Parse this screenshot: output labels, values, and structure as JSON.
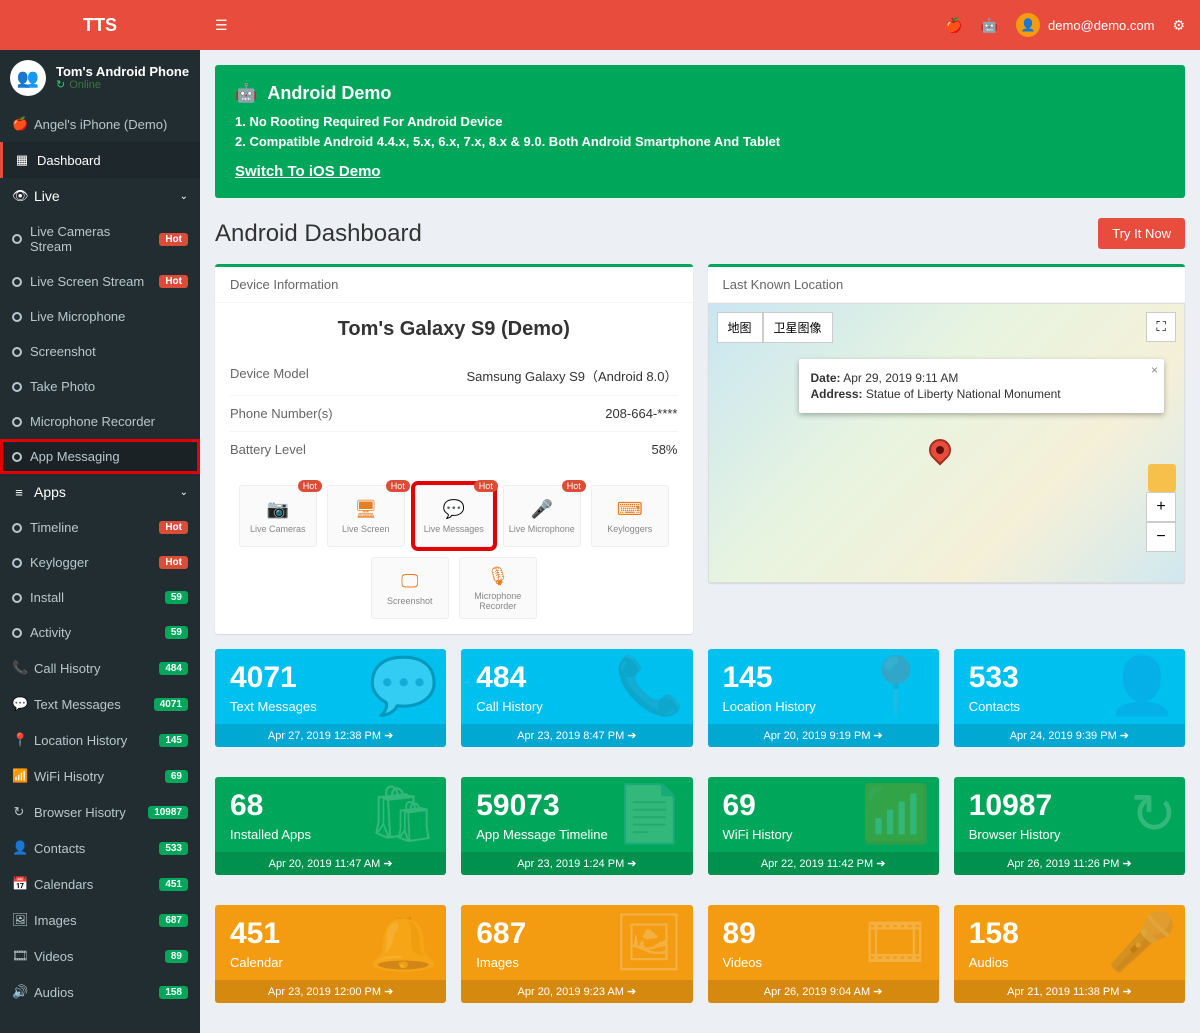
{
  "brand": "TTS",
  "user": {
    "device_name": "Tom's Android Phone",
    "status": "Online"
  },
  "topbar": {
    "user_email": "demo@demo.com"
  },
  "sidebar": {
    "demo_item": "Angel's iPhone (Demo)",
    "dashboard": "Dashboard",
    "live_header": "Live",
    "live_items": [
      {
        "label": "Live Cameras Stream",
        "badge": "Hot",
        "badge_class": "bg-red",
        "circle": "c-red"
      },
      {
        "label": "Live Screen Stream",
        "badge": "Hot",
        "badge_class": "bg-red",
        "circle": "c-red"
      },
      {
        "label": "Live Microphone",
        "circle": "c-aqua"
      },
      {
        "label": "Screenshot",
        "circle": "c-aqua"
      },
      {
        "label": "Take Photo",
        "circle": "c-aqua"
      },
      {
        "label": "Microphone Recorder",
        "circle": "c-aqua"
      },
      {
        "label": "App Messaging",
        "circle": "c-red",
        "highlight": true
      }
    ],
    "apps_header": "Apps",
    "apps_items": [
      {
        "label": "Timeline",
        "badge": "Hot",
        "badge_class": "bg-red",
        "circle": "c-red"
      },
      {
        "label": "Keylogger",
        "badge": "Hot",
        "badge_class": "bg-red",
        "circle": "c-aqua"
      },
      {
        "label": "Install",
        "badge": "59",
        "badge_class": "bg-green",
        "circle": "c-green"
      },
      {
        "label": "Activity",
        "badge": "59",
        "badge_class": "bg-green",
        "circle": "c-green"
      }
    ],
    "main_items": [
      {
        "icon": "📞",
        "label": "Call Hisotry",
        "badge": "484"
      },
      {
        "icon": "💬",
        "label": "Text Messages",
        "badge": "4071"
      },
      {
        "icon": "📍",
        "label": "Location History",
        "badge": "145"
      },
      {
        "icon": "📶",
        "label": "WiFi Hisotry",
        "badge": "69"
      },
      {
        "icon": "↻",
        "label": "Browser Hisotry",
        "badge": "10987"
      },
      {
        "icon": "👤",
        "label": "Contacts",
        "badge": "533"
      },
      {
        "icon": "📅",
        "label": "Calendars",
        "badge": "451"
      },
      {
        "icon": "🖼",
        "label": "Images",
        "badge": "687"
      },
      {
        "icon": "🎞",
        "label": "Videos",
        "badge": "89"
      },
      {
        "icon": "🔊",
        "label": "Audios",
        "badge": "158"
      }
    ]
  },
  "callout": {
    "title": "Android Demo",
    "line1": "1. No Rooting Required For Android Device",
    "line2": "2. Compatible Android 4.4.x, 5.x, 6.x, 7.x, 8.x & 9.0. Both Android Smartphone And Tablet",
    "link": "Switch To iOS Demo"
  },
  "page": {
    "title": "Android Dashboard",
    "try_btn": "Try It Now"
  },
  "device_box": {
    "header": "Device Information",
    "title": "Tom's Galaxy S9 (Demo)",
    "rows": [
      {
        "label": "Device Model",
        "value": "Samsung Galaxy S9（Android 8.0）"
      },
      {
        "label": "Phone Number(s)",
        "value": "208-664-****"
      },
      {
        "label": "Battery Level",
        "value": "58%"
      }
    ],
    "tiles": [
      {
        "icon": "📷",
        "label": "Live Cameras",
        "hot": "Hot"
      },
      {
        "icon": "🖥",
        "label": "Live Screen",
        "hot": "Hot"
      },
      {
        "icon": "💬",
        "label": "Live Messages",
        "hot": "Hot",
        "highlight": true
      },
      {
        "icon": "🎤",
        "label": "Live Microphone",
        "hot": "Hot"
      },
      {
        "icon": "⌨",
        "label": "Keyloggers"
      },
      {
        "icon": "🖵",
        "label": "Screenshot"
      },
      {
        "icon": "🎙",
        "label": "Microphone Recorder"
      }
    ]
  },
  "map_box": {
    "header": "Last Known Location",
    "btn_map": "地图",
    "btn_sat": "卫星图像",
    "info_date_label": "Date:",
    "info_date": "Apr 29, 2019 9:11 AM",
    "info_addr_label": "Address:",
    "info_addr": "Statue of Liberty National Monument"
  },
  "stats": [
    {
      "count": "4071",
      "label": "Text Messages",
      "date": "Apr 27, 2019 12:38 PM",
      "color": "sb-aqua",
      "icon": "💬"
    },
    {
      "count": "484",
      "label": "Call History",
      "date": "Apr 23, 2019 8:47 PM",
      "color": "sb-aqua",
      "icon": "📞"
    },
    {
      "count": "145",
      "label": "Location History",
      "date": "Apr 20, 2019 9:19 PM",
      "color": "sb-aqua",
      "icon": "📍"
    },
    {
      "count": "533",
      "label": "Contacts",
      "date": "Apr 24, 2019 9:39 PM",
      "color": "sb-aqua",
      "icon": "👤"
    },
    {
      "count": "68",
      "label": "Installed Apps",
      "date": "Apr 20, 2019 11:47 AM",
      "color": "sb-green",
      "icon": "🛍"
    },
    {
      "count": "59073",
      "label": "App Message Timeline",
      "date": "Apr 23, 2019 1:24 PM",
      "color": "sb-green",
      "icon": "📄"
    },
    {
      "count": "69",
      "label": "WiFi History",
      "date": "Apr 22, 2019 11:42 PM",
      "color": "sb-green",
      "icon": "📶"
    },
    {
      "count": "10987",
      "label": "Browser History",
      "date": "Apr 26, 2019 11:26 PM",
      "color": "sb-green",
      "icon": "↻"
    },
    {
      "count": "451",
      "label": "Calendar",
      "date": "Apr 23, 2019 12:00 PM",
      "color": "sb-yellow",
      "icon": "🔔"
    },
    {
      "count": "687",
      "label": "Images",
      "date": "Apr 20, 2019 9:23 AM",
      "color": "sb-yellow",
      "icon": "🖼"
    },
    {
      "count": "89",
      "label": "Videos",
      "date": "Apr 26, 2019 9:04 AM",
      "color": "sb-yellow",
      "icon": "🎞"
    },
    {
      "count": "158",
      "label": "Audios",
      "date": "Apr 21, 2019 11:38 PM",
      "color": "sb-yellow",
      "icon": "🎤"
    }
  ]
}
